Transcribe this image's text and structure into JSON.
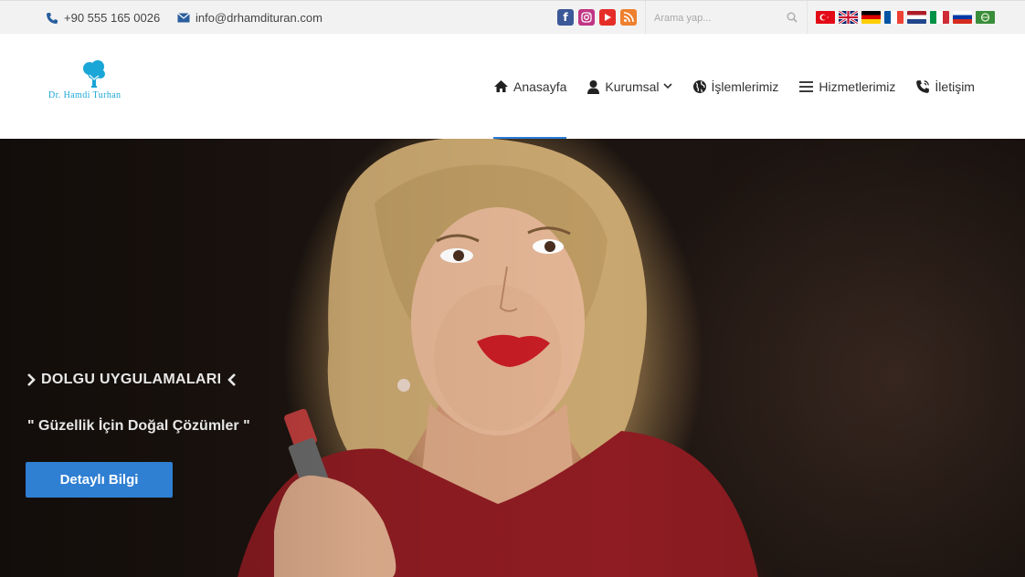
{
  "topbar": {
    "phone": "+90 555 165 0026",
    "email": "info@drhamdituran.com",
    "search_placeholder": "Arama yap...",
    "socials": [
      "facebook-icon",
      "instagram-icon",
      "youtube-icon",
      "rss-icon"
    ],
    "flags": [
      "turkish",
      "english",
      "german",
      "french",
      "dutch",
      "italian",
      "russian",
      "arabic"
    ]
  },
  "header": {
    "logo_text": "Dr. Hamdi Turhan",
    "nav": [
      {
        "label": "Anasayfa",
        "icon": "home-icon",
        "active": true
      },
      {
        "label": "Kurumsal",
        "icon": "user-icon",
        "dropdown": true
      },
      {
        "label": "İşlemlerimiz",
        "icon": "globe-icon"
      },
      {
        "label": "Hizmetlerimiz",
        "icon": "menu-icon"
      },
      {
        "label": "İletişim",
        "icon": "phone-icon"
      }
    ]
  },
  "hero": {
    "title": "DOLGU UYGULAMALARI",
    "subtitle": "\" Güzellik İçin Doğal Çözümler \"",
    "button": "Detaylı Bilgi"
  },
  "colors": {
    "accent": "#2f7fd2",
    "logo": "#1aa6d6",
    "topbar_bg": "#f2f2f2"
  }
}
